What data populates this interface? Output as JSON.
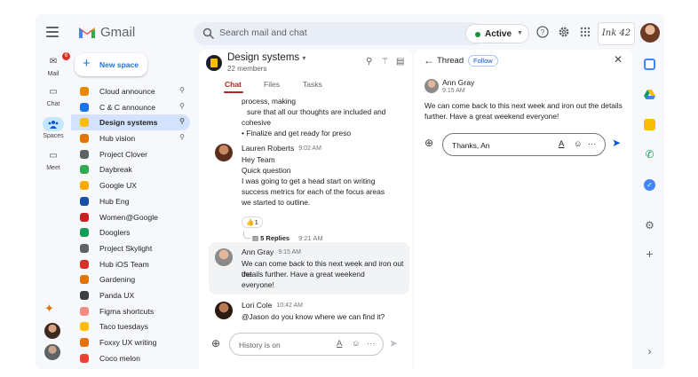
{
  "app": {
    "name": "Gmail"
  },
  "search": {
    "placeholder": "Search mail and chat"
  },
  "status": {
    "label": "Active"
  },
  "brand": {
    "text": "Ink 42"
  },
  "rail": {
    "mail": {
      "label": "Mail",
      "badge": "6"
    },
    "chat": {
      "label": "Chat"
    },
    "spaces": {
      "label": "Spaces"
    },
    "meet": {
      "label": "Meet"
    }
  },
  "new_space": {
    "label": "New space"
  },
  "spaces": [
    {
      "name": "Cloud announce",
      "color": "#ea8600",
      "pinned": true
    },
    {
      "name": "C & C announce",
      "color": "#1a73e8",
      "pinned": true
    },
    {
      "name": "Design systems",
      "color": "#fbbc04",
      "pinned": true,
      "selected": true
    },
    {
      "name": "Hub vision",
      "color": "#e37400",
      "pinned": true
    },
    {
      "name": "Project Clover",
      "color": "#5f6368",
      "pinned": false
    },
    {
      "name": "Daybreak",
      "color": "#34a853",
      "pinned": false
    },
    {
      "name": "Google UX",
      "color": "#f9ab00",
      "pinned": false
    },
    {
      "name": "Hub Eng",
      "color": "#174ea6",
      "pinned": false
    },
    {
      "name": "Women@Google",
      "color": "#c5221f",
      "pinned": false
    },
    {
      "name": "Dooglers",
      "color": "#0f9d58",
      "pinned": false
    },
    {
      "name": "Project Skylight",
      "color": "#5f6368",
      "pinned": false
    },
    {
      "name": "Hub iOS Team",
      "color": "#d93025",
      "pinned": false
    },
    {
      "name": "Gardening",
      "color": "#e37400",
      "pinned": false
    },
    {
      "name": "Panda UX",
      "color": "#3c4043",
      "pinned": false
    },
    {
      "name": "Figma shortcuts",
      "color": "#f28b82",
      "pinned": false
    },
    {
      "name": "Taco tuesdays",
      "color": "#fbbc04",
      "pinned": false
    },
    {
      "name": "Foxxy UX writing",
      "color": "#e8710a",
      "pinned": false
    },
    {
      "name": "Coco melon",
      "color": "#ea4335",
      "pinned": false
    }
  ],
  "chat": {
    "title": "Design systems",
    "members": "22 members",
    "tabs": [
      "Chat",
      "Files",
      "Tasks"
    ],
    "top_text": {
      "line1": "process, making",
      "line2": "sure that all our thoughts are included and",
      "line3": "cohesive",
      "bullet": "Finalize and get ready for preso"
    },
    "messages": [
      {
        "author": "Lauren Roberts",
        "time": "9:02 AM",
        "lines": [
          "Hey Team",
          "Quick question",
          "I was going to get a head start on writing",
          "success metrics for each of the focus areas",
          "we started to outline."
        ]
      },
      {
        "author": "Ann Gray",
        "time": "9:15 AM",
        "lines": [
          "We can come back to this next week and iron out the",
          "details further. Have a great weekend",
          "everyone!"
        ]
      },
      {
        "author": "Lori Cole",
        "time": "10:42 AM",
        "lines": [
          "@Jason do you know where we can find it?"
        ]
      }
    ],
    "reaction": {
      "emoji": "👍",
      "count": "1"
    },
    "replies": {
      "label": "5 Replies",
      "time": "9:21 AM"
    },
    "compose_placeholder": "History is on"
  },
  "thread": {
    "title": "Thread",
    "follow": "Follow",
    "author": "Ann Gray",
    "time": "9:15 AM",
    "lines": [
      "We can come back to this next week and iron out the details",
      "further. Have a great weekend everyone!"
    ],
    "compose_value": "Thanks, An"
  },
  "colors": {
    "accent": "#0b57d0",
    "selected": "#d3e3fd",
    "tab_active": "#b3261e"
  }
}
